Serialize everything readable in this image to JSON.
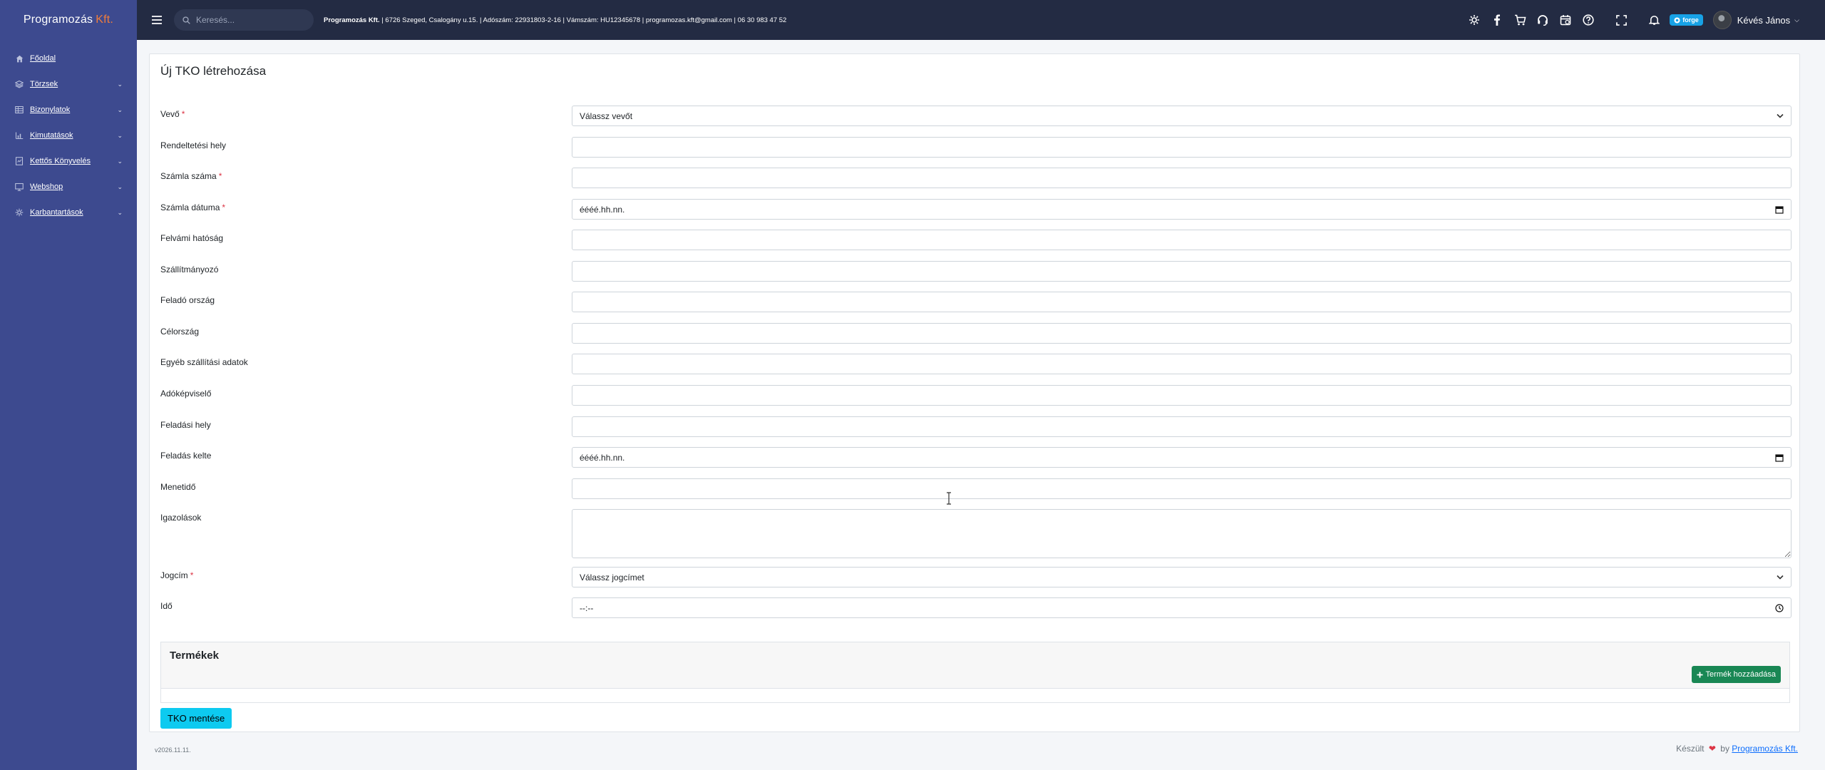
{
  "brand": {
    "name": "Programozás",
    "accent": "Kft."
  },
  "sidebar": {
    "items": [
      {
        "label": "Főoldal",
        "icon": "home-icon",
        "has_submenu": false
      },
      {
        "label": "Törzsek",
        "icon": "stack-icon",
        "has_submenu": true
      },
      {
        "label": "Bizonylatok",
        "icon": "table-icon",
        "has_submenu": true
      },
      {
        "label": "Kimutatások",
        "icon": "chart-icon",
        "has_submenu": true
      },
      {
        "label": "Kettős Könyvelés",
        "icon": "ledger-icon",
        "has_submenu": true
      },
      {
        "label": "Webshop",
        "icon": "monitor-icon",
        "has_submenu": true
      },
      {
        "label": "Karbantartások",
        "icon": "gear-icon",
        "has_submenu": true
      }
    ]
  },
  "topbar": {
    "search_placeholder": "Keresés...",
    "company_name": "Programozás Kft.",
    "company_details": "| 6726 Szeged, Csalogány u.15. | Adószám: 22931803-2-16 | Vámszám: HU12345678 | programozas.kft@gmail.com | 06 30 983 47 52",
    "forge_badge": "forge",
    "user_name": "Kévés János"
  },
  "form": {
    "title": "Új TKO létrehozása",
    "fields": [
      {
        "label": "Vevő",
        "required": true,
        "type": "select",
        "value": "Válassz vevőt"
      },
      {
        "label": "Rendeltetési hely",
        "required": false,
        "type": "text",
        "value": ""
      },
      {
        "label": "Számla száma",
        "required": true,
        "type": "text",
        "value": ""
      },
      {
        "label": "Számla dátuma",
        "required": true,
        "type": "date",
        "value": "éééé.hh.nn."
      },
      {
        "label": "Felvámi hatóság",
        "required": false,
        "type": "text",
        "value": ""
      },
      {
        "label": "Szállítmányozó",
        "required": false,
        "type": "text",
        "value": ""
      },
      {
        "label": "Feladó ország",
        "required": false,
        "type": "text",
        "value": ""
      },
      {
        "label": "Célország",
        "required": false,
        "type": "text",
        "value": ""
      },
      {
        "label": "Egyéb szállítási adatok",
        "required": false,
        "type": "text",
        "value": ""
      },
      {
        "label": "Adóképviselő",
        "required": false,
        "type": "text",
        "value": ""
      },
      {
        "label": "Feladási hely",
        "required": false,
        "type": "text",
        "value": ""
      },
      {
        "label": "Feladás kelte",
        "required": false,
        "type": "date",
        "value": "éééé.hh.nn."
      },
      {
        "label": "Menetidő",
        "required": false,
        "type": "text",
        "value": ""
      },
      {
        "label": "Igazolások",
        "required": false,
        "type": "textarea",
        "value": ""
      },
      {
        "label": "Jogcím",
        "required": true,
        "type": "select",
        "value": "Válassz jogcímet"
      },
      {
        "label": "Idő",
        "required": false,
        "type": "time",
        "value": "--:--"
      }
    ],
    "required_marker": "*",
    "products_title": "Termékek",
    "add_product_label": "Termék hozzáadása",
    "save_label": "TKO mentése"
  },
  "footer": {
    "version": "v2026.11.11.",
    "made_prefix": "Készült",
    "made_by": "by",
    "made_link": "Programozás Kft."
  },
  "colors": {
    "sidebar_bg": "#3d4a8f",
    "topbar_bg": "#232b43",
    "brand_accent": "#f07c3b",
    "add_button": "#198754",
    "save_button": "#0dcaf0",
    "required": "#dc3545"
  }
}
